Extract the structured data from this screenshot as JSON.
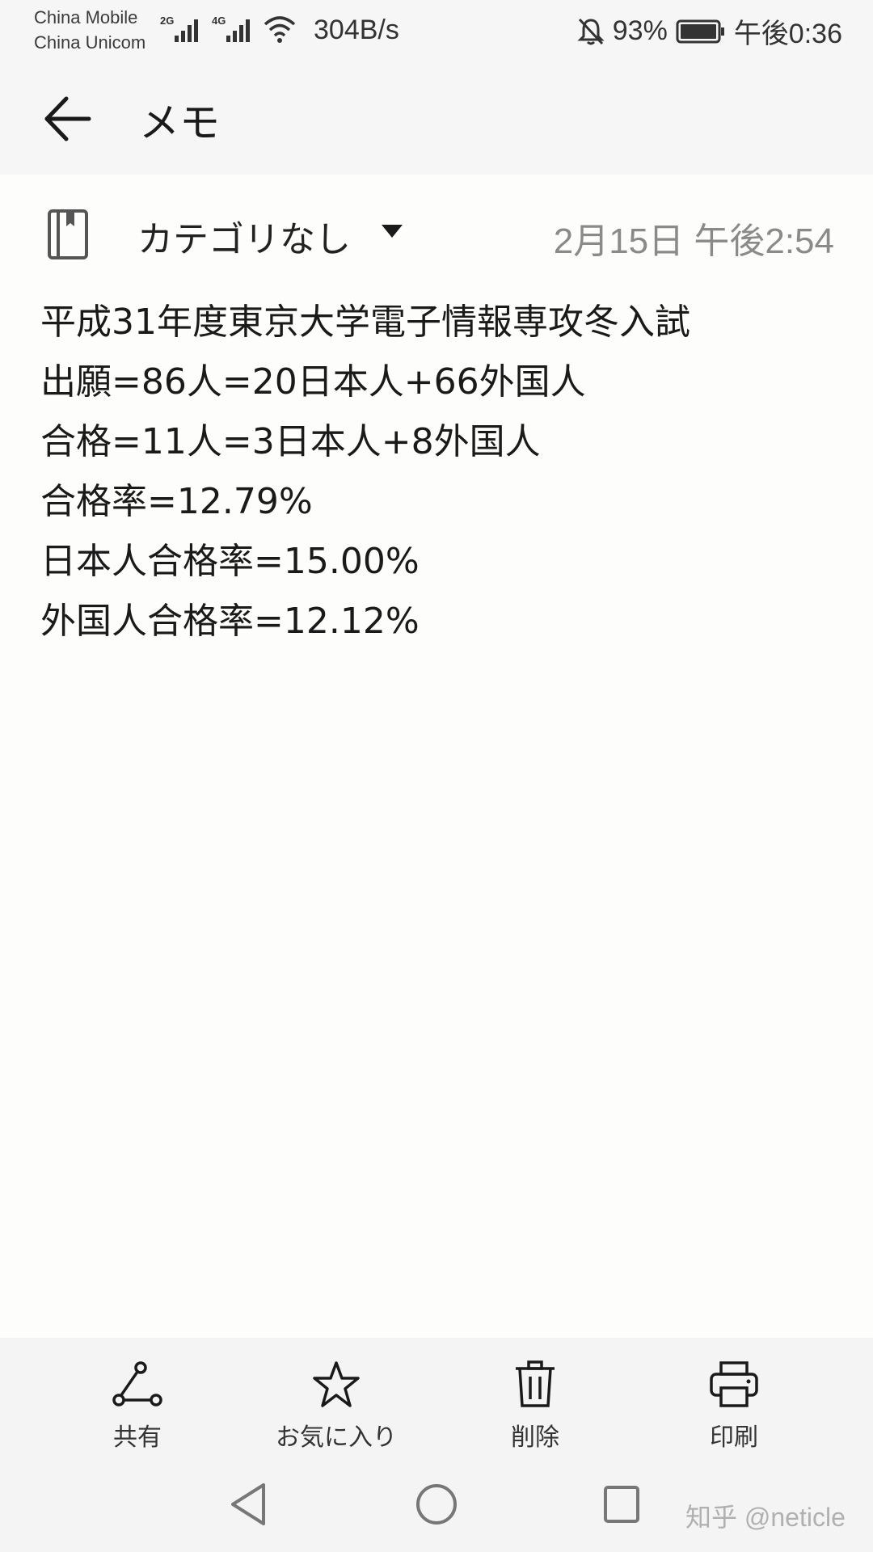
{
  "status_bar": {
    "carrier_1": "China Mobile",
    "carrier_2": "China Unicom",
    "signal_1_type": "2G",
    "signal_2_type": "4G",
    "net_speed": "304B/s",
    "battery": "93%",
    "time": "午後0:36",
    "icons": [
      "signal-icon",
      "wifi-icon",
      "mute-bell-icon",
      "battery-icon"
    ]
  },
  "app_bar": {
    "title": "メモ",
    "back_icon": "arrow-left-icon"
  },
  "note": {
    "category": "カテゴリなし",
    "date": "2月15日 午後2:54",
    "lines": [
      "平成31年度東京大学電子情報専攻冬入試",
      "出願=86人=20日本人+66外国人",
      "合格=11人=3日本人+8外国人",
      "合格率=12.79%",
      "日本人合格率=15.00%",
      "外国人合格率=12.12%"
    ]
  },
  "toolbar": {
    "share_label": "共有",
    "favorite_label": "お気に入り",
    "delete_label": "削除",
    "print_label": "印刷"
  },
  "nav": {
    "icons": [
      "back-triangle-icon",
      "home-circle-icon",
      "recents-square-icon"
    ]
  },
  "watermark": "知乎 @neticle"
}
